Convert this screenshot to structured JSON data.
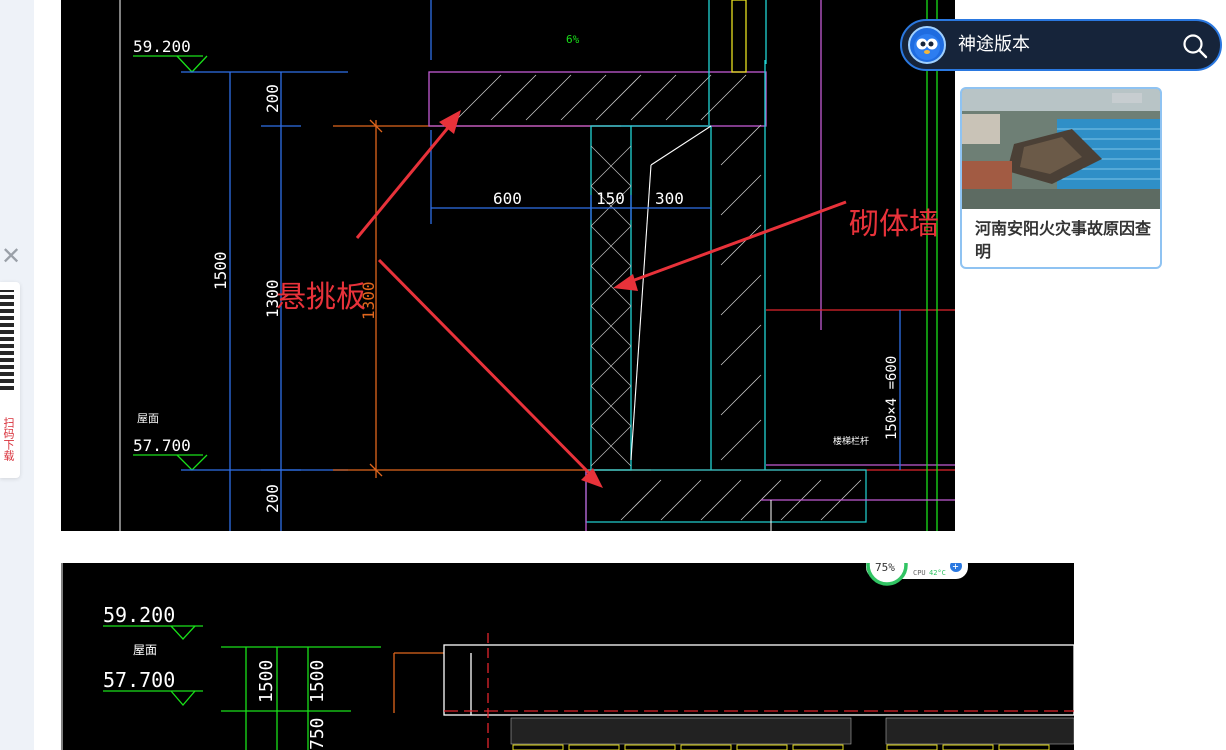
{
  "sidebar": {
    "close_symbol": "✕",
    "qr_caption": "扫码下载"
  },
  "cad1": {
    "elev_top": "59.200",
    "elev_bottom": "57.700",
    "floor_label": "屋面",
    "slope": "6%",
    "dim_200_top": "200",
    "dim_1500": "1500",
    "dim_1300": "1300",
    "dim_1300_orange": "1300",
    "dim_200_bottom": "200",
    "dim_600": "600",
    "dim_150": "150",
    "dim_300": "300",
    "dim_stair": "150×4 =600",
    "small_note": "楼梯栏杆"
  },
  "annotations": {
    "cantilever_slab": "悬挑板",
    "masonry_wall": "砌体墙"
  },
  "cad2": {
    "elev_top": "59.200",
    "elev_bottom": "57.700",
    "floor_label": "屋面",
    "dim_1500_a": "1500",
    "dim_1500_b": "1500",
    "dim_750": "750",
    "perf_percent": "75%",
    "cpu_label": "CPU",
    "cpu_temp": "42°C"
  },
  "search_widget": {
    "label": "神途版本",
    "icons": [
      "mascot-avatar-icon",
      "search-icon"
    ]
  },
  "news_card": {
    "title": "河南安阳火灾事故原因查明"
  },
  "colors": {
    "cad_background": "#000000",
    "annotation_red": "#e8323a",
    "pill_border": "#2a78e0"
  }
}
